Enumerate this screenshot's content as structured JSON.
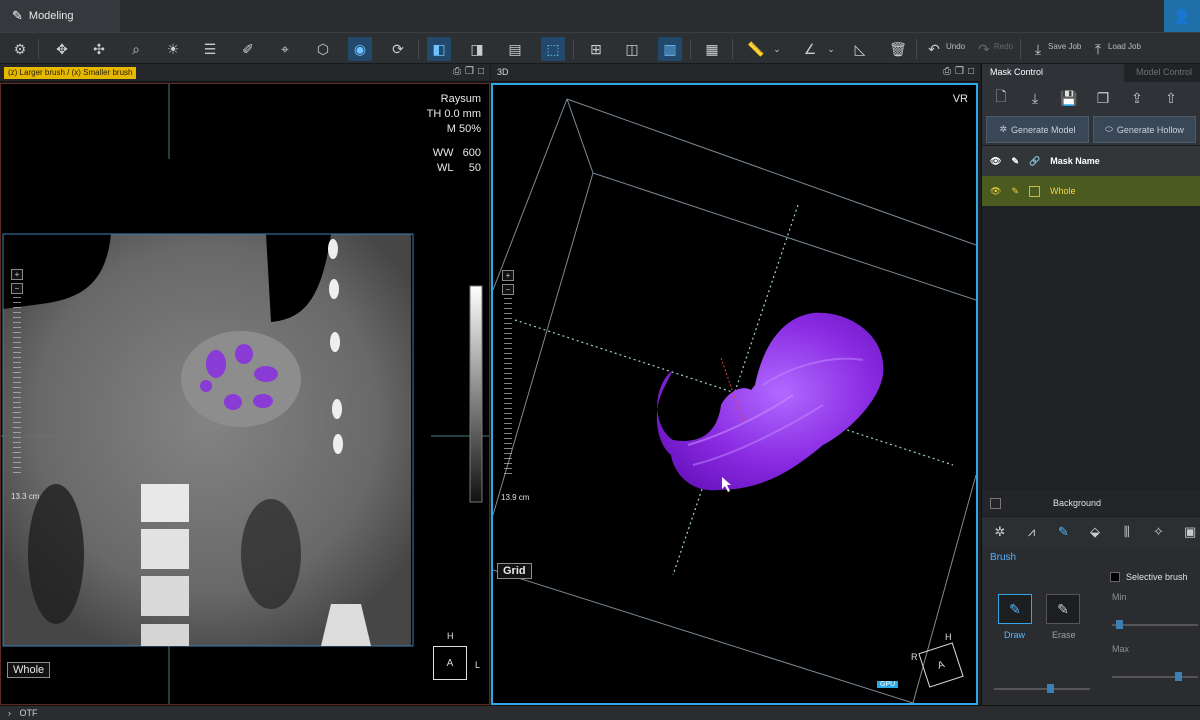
{
  "titlebar": {
    "tab_label": "Modeling"
  },
  "toolbar": {
    "undo_label": "Undo",
    "redo_label": "Redo",
    "save_job_label": "Save Job",
    "load_job_label": "Load Job"
  },
  "left_view": {
    "hint": "(z) Larger brush / (x) Smaller brush",
    "render_mode": "Raysum",
    "thickness": "TH 0.0 mm",
    "mix": "M 50%",
    "ww_label": "WW",
    "ww_value": "600",
    "wl_label": "WL",
    "wl_value": "50",
    "ruler_length": "13.3 cm",
    "mask_badge": "Whole",
    "orient_top": "H",
    "orient_center": "A",
    "orient_right": "L"
  },
  "right_view": {
    "title": "3D",
    "render_mode": "VR",
    "ruler_length": "13.9 cm",
    "grid_badge": "Grid",
    "gpu_badge": "GPU",
    "orient_top": "H",
    "orient_left": "R",
    "orient_center": "A"
  },
  "panel": {
    "tab_active": "Mask Control",
    "tab_inactive": "Model Control",
    "generate_model": "Generate Model",
    "generate_hollow": "Generate Hollow",
    "mask_name_header": "Mask Name",
    "masks": [
      {
        "name": "Whole",
        "color": "#f5d640"
      }
    ],
    "background_label": "Background",
    "brush_title": "Brush",
    "selective_brush": "Selective brush",
    "draw_label": "Draw",
    "erase_label": "Erase",
    "min_label": "Min",
    "max_label": "Max",
    "brush_size_fraction": 0.6,
    "min_fraction": 0.05,
    "max_fraction": 0.8
  },
  "bottom": {
    "label": "OTF"
  },
  "colors": {
    "accent": "#2fa6e6",
    "mask_purple": "#8a2be2",
    "mask_active": "#f5d640"
  }
}
